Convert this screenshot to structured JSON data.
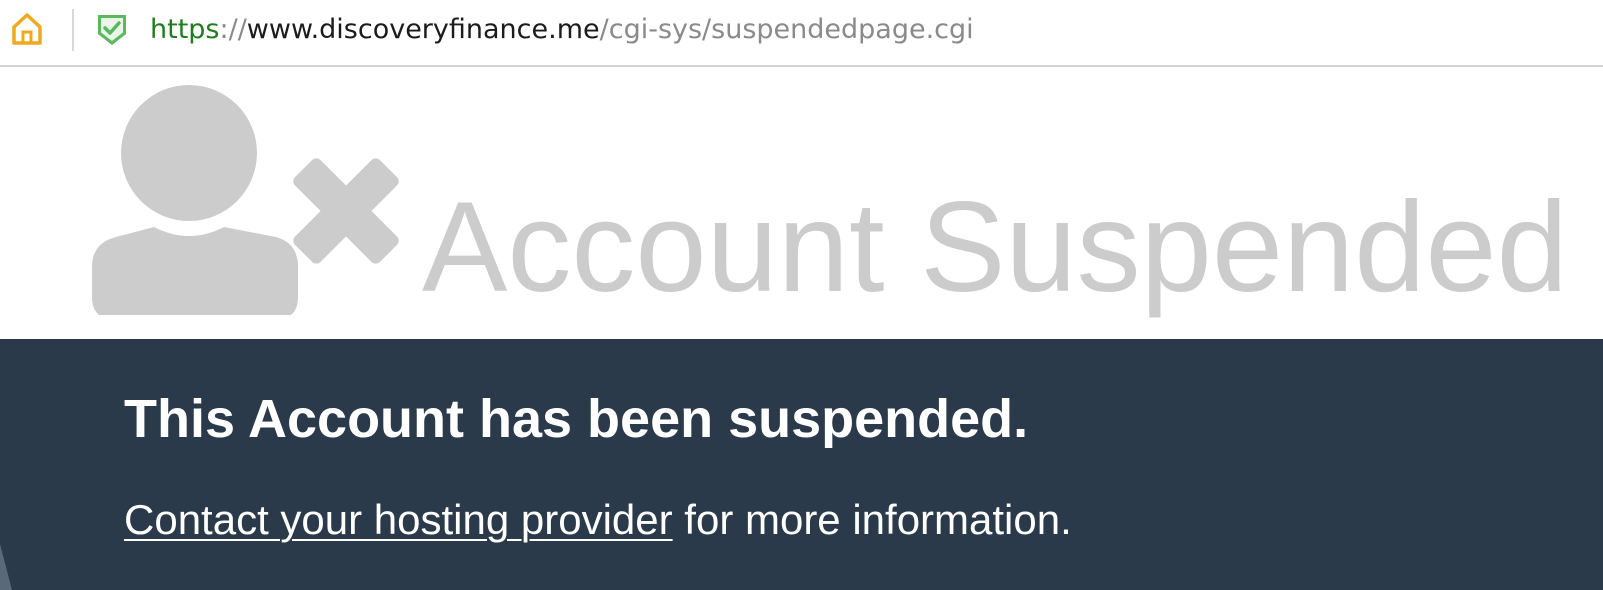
{
  "browser": {
    "url_scheme": "https",
    "url_separator": "://",
    "url_host": "www.discoveryfinance.me",
    "url_path": "/cgi-sys/suspendedpage.cgi",
    "home_icon": "home-icon",
    "security_icon": "shield-check-icon",
    "colors": {
      "home": "#f0a81c",
      "shield": "#5bb85d",
      "scheme": "#1f7d1f"
    }
  },
  "hero": {
    "title": "Account Suspended",
    "icon": "user-x-icon",
    "icon_color": "#cccccc"
  },
  "panel": {
    "headline": "This Account has been suspended.",
    "link_text": "Contact your hosting provider",
    "info_suffix": " for more information.",
    "background": "#2b3a4b"
  }
}
